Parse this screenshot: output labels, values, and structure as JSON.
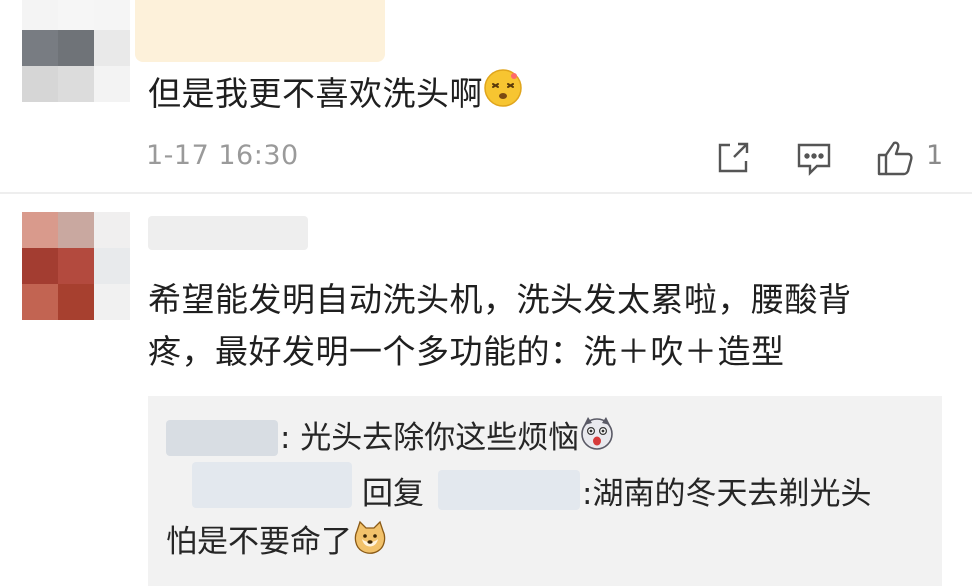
{
  "comment1": {
    "text": "但是我更不喜欢洗头啊",
    "emoji": "😵",
    "time": "1-17 16:30",
    "actions": {
      "share_icon": "share-icon",
      "comment_icon": "comment-icon",
      "like_icon": "like-icon",
      "like_count": "1"
    }
  },
  "comment2": {
    "text_line1": "希望能发明自动洗头机，洗头发太累啦，腰酸背",
    "text_line2": "疼，最好发明一个多功能的：洗＋吹＋造型",
    "replies": [
      {
        "prefix": ": 光头去除你这些烦恼",
        "emoji": "🙀"
      },
      {
        "reply_label": "回复",
        "text_line1": ":湖南的冬天去剃光头",
        "text_line2": "怕是不要命了",
        "emoji": "🐶"
      }
    ]
  },
  "colors": {
    "text": "#1f1f1f",
    "meta": "#9a9a9a",
    "reply_bg": "#f2f2f2",
    "icon": "#555555"
  }
}
